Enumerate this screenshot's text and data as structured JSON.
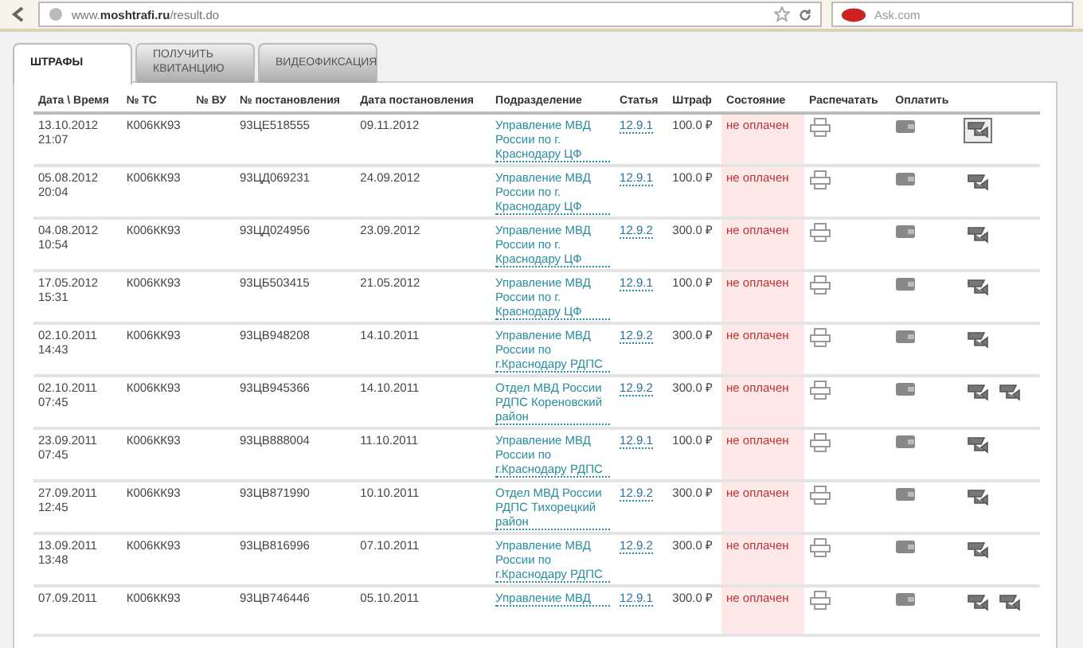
{
  "browser": {
    "url": {
      "host": "www.",
      "domain": "moshtrafi.ru",
      "path": "/result.do"
    },
    "search": "Ask.com"
  },
  "tabs": [
    {
      "label": "ШТРАФЫ",
      "selected": true
    },
    {
      "label": "ПОЛУЧИТЬ КВИТАНЦИЮ",
      "selected": false
    },
    {
      "label": "ВИДЕОФИКСАЦИЯ",
      "selected": false
    }
  ],
  "table": {
    "columns": [
      "Дата \\ Время",
      "№ ТС",
      "№ ВУ",
      "№ постановления",
      "Дата постановления",
      "Подразделение",
      "Статья",
      "Штраф",
      "Состояние",
      "Распечатать",
      "Оплатить"
    ],
    "rows": [
      {
        "date": "13.10.2012",
        "time": "21:07",
        "vehicle": "К006КК93",
        "license": "",
        "ruling": "93ЦЕ518555",
        "ruling_date": "09.11.2012",
        "department": "Управление МВД России по г. Краснодару ЦФ",
        "article": "12.9.1",
        "fine": "100.0 ₽",
        "status": "не оплачен",
        "videos": [
          {
            "highlighted": true
          }
        ]
      },
      {
        "date": "05.08.2012",
        "time": "20:04",
        "vehicle": "К006КК93",
        "license": "",
        "ruling": "93ЦД069231",
        "ruling_date": "24.09.2012",
        "department": "Управление МВД России по г. Краснодару ЦФ",
        "article": "12.9.1",
        "fine": "100.0 ₽",
        "status": "не оплачен",
        "videos": [
          {
            "highlighted": false
          }
        ]
      },
      {
        "date": "04.08.2012",
        "time": "10:54",
        "vehicle": "К006КК93",
        "license": "",
        "ruling": "93ЦД024956",
        "ruling_date": "23.09.2012",
        "department": "Управление МВД России по г. Краснодару ЦФ",
        "article": "12.9.2",
        "fine": "300.0 ₽",
        "status": "не оплачен",
        "videos": [
          {
            "highlighted": false
          }
        ]
      },
      {
        "date": "17.05.2012",
        "time": "15:31",
        "vehicle": "К006КК93",
        "license": "",
        "ruling": "93ЦБ503415",
        "ruling_date": "21.05.2012",
        "department": "Управление МВД России по г. Краснодару ЦФ",
        "article": "12.9.1",
        "fine": "100.0 ₽",
        "status": "не оплачен",
        "videos": [
          {
            "highlighted": false
          }
        ]
      },
      {
        "date": "02.10.2011",
        "time": "14:43",
        "vehicle": "К006КК93",
        "license": "",
        "ruling": "93ЦВ948208",
        "ruling_date": "14.10.2011",
        "department": "Управление МВД России по г.Краснодару РДПС",
        "article": "12.9.2",
        "fine": "300.0 ₽",
        "status": "не оплачен",
        "videos": [
          {
            "highlighted": false
          }
        ]
      },
      {
        "date": "02.10.2011",
        "time": "07:45",
        "vehicle": "К006КК93",
        "license": "",
        "ruling": "93ЦВ945366",
        "ruling_date": "14.10.2011",
        "department": "Отдел МВД России РДПС Кореновский район",
        "article": "12.9.2",
        "fine": "300.0 ₽",
        "status": "не оплачен",
        "videos": [
          {
            "highlighted": false
          },
          {
            "highlighted": false
          }
        ]
      },
      {
        "date": "23.09.2011",
        "time": "07:45",
        "vehicle": "К006КК93",
        "license": "",
        "ruling": "93ЦВ888004",
        "ruling_date": "11.10.2011",
        "department": "Управление МВД России по г.Краснодару РДПС",
        "article": "12.9.1",
        "fine": "100.0 ₽",
        "status": "не оплачен",
        "videos": [
          {
            "highlighted": false
          }
        ]
      },
      {
        "date": "27.09.2011",
        "time": "12:45",
        "vehicle": "К006КК93",
        "license": "",
        "ruling": "93ЦВ871990",
        "ruling_date": "10.10.2011",
        "department": "Отдел МВД России РДПС Тихорецкий район",
        "article": "12.9.2",
        "fine": "300.0 ₽",
        "status": "не оплачен",
        "videos": [
          {
            "highlighted": false
          }
        ]
      },
      {
        "date": "13.09.2011",
        "time": "13:48",
        "vehicle": "К006КК93",
        "license": "",
        "ruling": "93ЦВ816996",
        "ruling_date": "07.10.2011",
        "department": "Управление МВД России по г.Краснодару РДПС",
        "article": "12.9.2",
        "fine": "300.0 ₽",
        "status": "не оплачен",
        "videos": [
          {
            "highlighted": false
          }
        ]
      },
      {
        "date": "07.09.2011",
        "time": "",
        "vehicle": "К006КК93",
        "license": "",
        "ruling": "93ЦВ746446",
        "ruling_date": "05.10.2011",
        "department": "Управление МВД",
        "article": "12.9.1",
        "fine": "300.0 ₽",
        "status": "не оплачен",
        "videos": [
          {
            "highlighted": false
          },
          {
            "highlighted": false
          }
        ]
      }
    ]
  }
}
